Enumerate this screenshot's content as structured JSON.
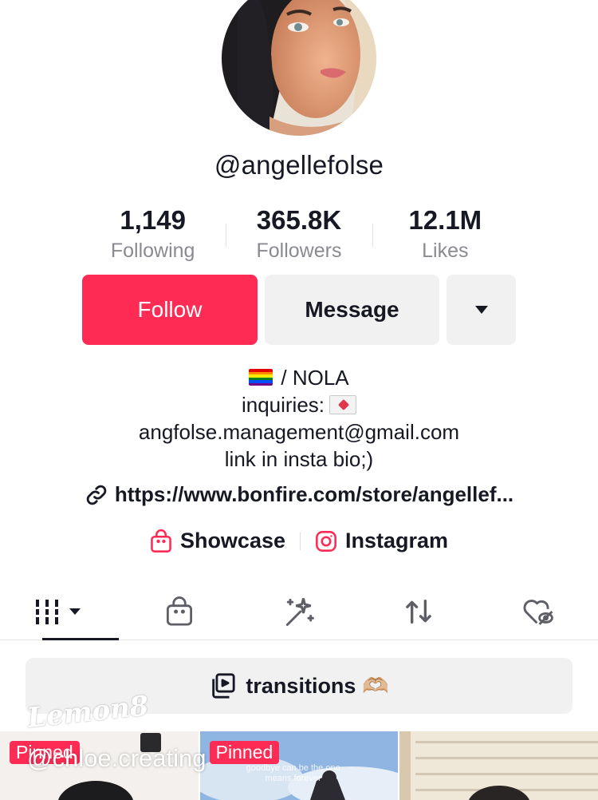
{
  "profile": {
    "username": "@angellefolse"
  },
  "stats": [
    {
      "value": "1,149",
      "label": "Following"
    },
    {
      "value": "365.8K",
      "label": "Followers"
    },
    {
      "value": "12.1M",
      "label": "Likes"
    }
  ],
  "actions": {
    "follow_label": "Follow",
    "message_label": "Message",
    "more_icon": "caret-down-icon"
  },
  "bio": {
    "line1_text": "/ NOLA",
    "line2_text": "inquiries:",
    "line3_text": "angfolse.management@gmail.com",
    "line4_text": "link in insta bio;)"
  },
  "link": {
    "url_text": "https://www.bonfire.com/store/angellef..."
  },
  "social": {
    "showcase_label": "Showcase",
    "instagram_label": "Instagram"
  },
  "tabs": [
    {
      "icon": "videos-grid-icon",
      "active": true
    },
    {
      "icon": "shopping-bag-icon",
      "active": false
    },
    {
      "icon": "magic-wand-icon",
      "active": false
    },
    {
      "icon": "repost-icon",
      "active": false
    },
    {
      "icon": "liked-hidden-icon",
      "active": false
    }
  ],
  "playlist": {
    "label": "transitions 🫶🏼"
  },
  "videos": [
    {
      "pinned_label": "Pinned",
      "overlay_text": ""
    },
    {
      "pinned_label": "Pinned",
      "overlay_text": "goodbye can be the one means forever"
    },
    {
      "pinned_label": "",
      "overlay_text": ""
    }
  ],
  "watermark": {
    "logo": "Lemon8",
    "handle": "@chloe.creating"
  },
  "colors": {
    "accent": "#fe2c55",
    "button_gray": "#f1f1f2",
    "text": "#161823",
    "muted": "#8a8b91"
  }
}
